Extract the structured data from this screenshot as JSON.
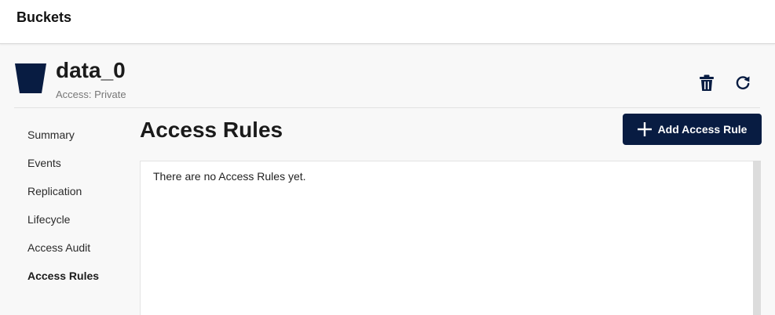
{
  "topbar": {
    "title": "Buckets"
  },
  "bucket": {
    "name": "data_0",
    "access": "Access: Private",
    "icon": "bucket-icon",
    "icon_color": "#081c42"
  },
  "actions": {
    "delete_icon": "trash-icon",
    "refresh_icon": "refresh-icon"
  },
  "sidebar": {
    "items": [
      {
        "label": "Summary",
        "active": false
      },
      {
        "label": "Events",
        "active": false
      },
      {
        "label": "Replication",
        "active": false
      },
      {
        "label": "Lifecycle",
        "active": false
      },
      {
        "label": "Access Audit",
        "active": false
      },
      {
        "label": "Access Rules",
        "active": true
      }
    ]
  },
  "main": {
    "title": "Access Rules",
    "add_button_label": "Add Access Rule",
    "add_button_icon": "plus-icon",
    "empty_message": "There are no Access Rules yet."
  },
  "colors": {
    "accent": "#081c42",
    "background": "#f8f8f8"
  }
}
